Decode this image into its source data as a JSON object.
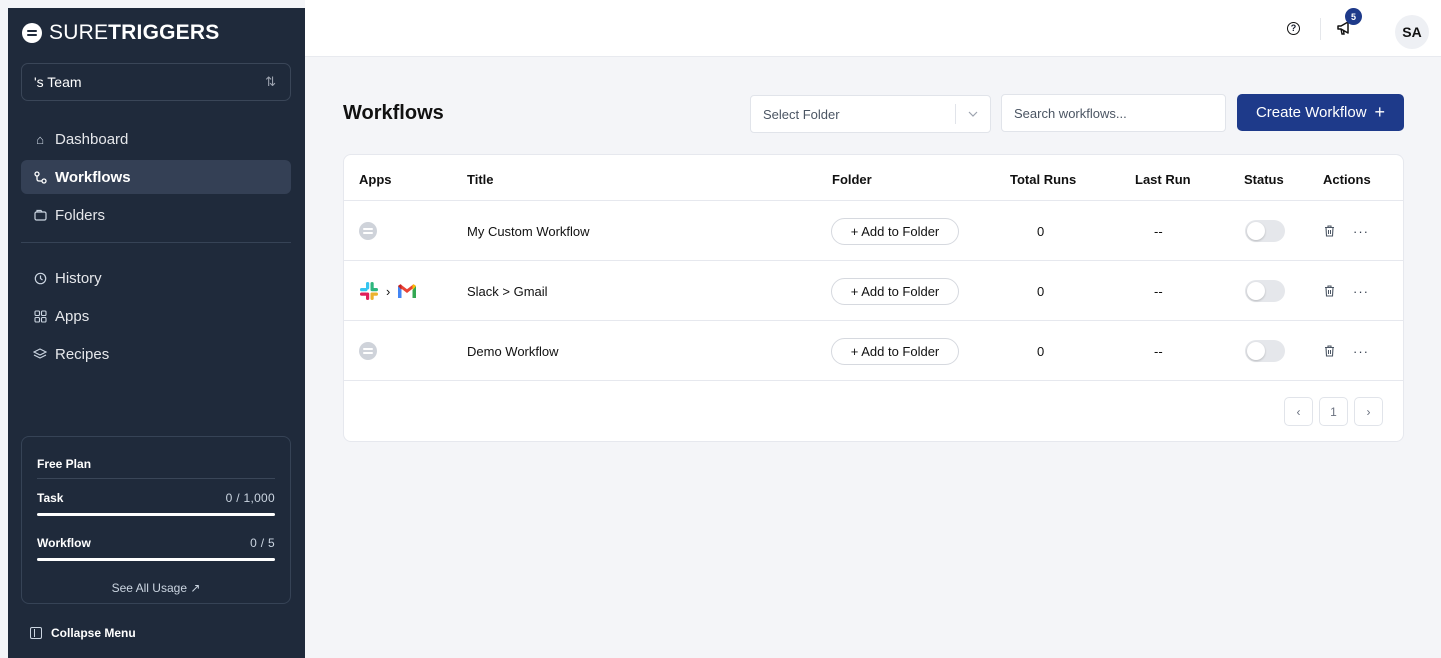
{
  "brand": {
    "name_light": "SURE",
    "name_bold": "TRIGGERS",
    "logo_icon": "suretriggers-logo-icon"
  },
  "team": {
    "label": "'s Team",
    "switch_icon": "switch-arrows-icon"
  },
  "nav": {
    "main": [
      {
        "label": "Dashboard",
        "icon": "home-icon",
        "active": false
      },
      {
        "label": "Workflows",
        "icon": "workflow-icon",
        "active": true
      },
      {
        "label": "Folders",
        "icon": "folder-icon",
        "active": false
      }
    ],
    "secondary": [
      {
        "label": "History",
        "icon": "history-icon",
        "active": false
      },
      {
        "label": "Apps",
        "icon": "apps-grid-icon",
        "active": false
      },
      {
        "label": "Recipes",
        "icon": "layers-icon",
        "active": false
      }
    ]
  },
  "plan": {
    "title": "Free Plan",
    "task_label": "Task",
    "task_value": "0 / 1,000",
    "task_fraction": 0,
    "workflow_label": "Workflow",
    "workflow_value": "0 / 5",
    "workflow_fraction": 0,
    "see_all_label": "See All Usage ↗"
  },
  "collapse_label": "Collapse Menu",
  "topbar": {
    "help_icon": "help-circle-icon",
    "notification_icon": "megaphone-icon",
    "notification_count": "5",
    "avatar_initials": "SA"
  },
  "page": {
    "title": "Workflows",
    "folder_select_placeholder": "Select Folder",
    "search_placeholder": "Search workflows...",
    "create_label": "Create Workflow"
  },
  "table": {
    "headers": {
      "apps": "Apps",
      "title": "Title",
      "folder": "Folder",
      "total_runs": "Total Runs",
      "last_run": "Last Run",
      "status": "Status",
      "actions": "Actions"
    },
    "rows": [
      {
        "apps": [
          "generic-app-icon"
        ],
        "title": "My Custom Workflow",
        "folder_action": "+ Add to Folder",
        "total_runs": "0",
        "last_run": "--",
        "status_on": false
      },
      {
        "apps": [
          "slack-icon",
          "gmail-icon"
        ],
        "title": "Slack > Gmail",
        "folder_action": "+ Add to Folder",
        "total_runs": "0",
        "last_run": "--",
        "status_on": false
      },
      {
        "apps": [
          "generic-app-icon"
        ],
        "title": "Demo Workflow",
        "folder_action": "+ Add to Folder",
        "total_runs": "0",
        "last_run": "--",
        "status_on": false
      }
    ]
  },
  "pagination": {
    "prev": "‹",
    "current": "1",
    "next": "›"
  },
  "colors": {
    "sidebar_bg": "#1f2a3b",
    "primary": "#1e3a8a",
    "page_bg": "#f4f5f8"
  }
}
